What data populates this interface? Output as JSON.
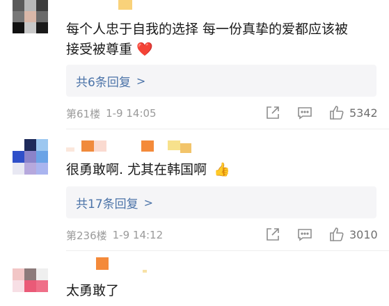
{
  "comments": [
    {
      "text_line1": "每个人忠于自我的选择 每一份真挚的爱都应该被",
      "text_line2": "接受被尊重",
      "emoji": "❤️",
      "reply_label": "共6条回复",
      "reply_chevron": ">",
      "floor": "第61楼",
      "time": "1-9 14:05",
      "likes": "5342"
    },
    {
      "text": "很勇敢啊. 尤其在韩国啊",
      "emoji": "👍",
      "reply_label": "共17条回复",
      "reply_chevron": ">",
      "floor": "第236楼",
      "time": "1-9 14:12",
      "likes": "3010"
    },
    {
      "text": "太勇敢了"
    }
  ],
  "colors": {
    "reply_link": "#4b73a8",
    "meta": "#9a9a9a",
    "icon": "#8d8d8d",
    "reply_bg": "#f5f5f7"
  },
  "icons": [
    "share-icon",
    "comment-icon",
    "like-icon"
  ]
}
